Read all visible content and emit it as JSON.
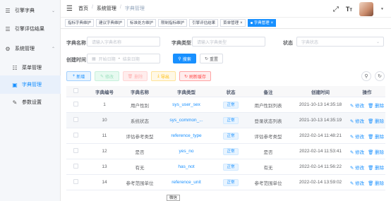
{
  "sidebar": {
    "items": [
      {
        "label": "引擎字典",
        "icon": "stack-icon",
        "arrow": "⌄"
      },
      {
        "label": "引擎评估结果",
        "icon": "stack-icon",
        "arrow": ""
      },
      {
        "label": "系统管理",
        "icon": "gear-icon",
        "arrow": "⌃"
      },
      {
        "label": "菜单管理",
        "icon": "tree-icon",
        "arrow": ""
      },
      {
        "label": "字典管理",
        "icon": "book-icon",
        "arrow": ""
      },
      {
        "label": "参数设置",
        "icon": "edit-icon",
        "arrow": ""
      }
    ]
  },
  "header": {
    "breadcrumb": [
      "首页",
      "系统管理",
      "字典管理"
    ],
    "icons": [
      "fullscreen-icon",
      "font-size-icon",
      "avatar"
    ]
  },
  "tags": [
    {
      "label": "指标字典维护",
      "active": false
    },
    {
      "label": "建议字典维护",
      "active": false
    },
    {
      "label": "标准处方维护",
      "active": false
    },
    {
      "label": "限制指标维护",
      "active": false
    },
    {
      "label": "引擎评估结果",
      "active": false
    },
    {
      "label": "菜单管理",
      "active": false,
      "closable": true
    },
    {
      "label": "字典管理",
      "active": true,
      "closable": true
    }
  ],
  "search": {
    "dict_name_label": "字典名称",
    "dict_name_placeholder": "请输入字典名称",
    "dict_type_label": "字典类型",
    "dict_type_placeholder": "请输入字典类型",
    "status_label": "状态",
    "status_placeholder": "字典状态",
    "created_label": "创建时间",
    "start_placeholder": "开始日期",
    "range_sep": "-",
    "end_placeholder": "结束日期",
    "search_btn": "搜索",
    "reset_btn": "重置"
  },
  "toolbar": {
    "add": "新增",
    "edit": "修改",
    "delete": "删除",
    "export": "导出",
    "refresh_cache": "刷新缓存"
  },
  "table": {
    "headers": [
      "字典编号",
      "字典名称",
      "字典类型",
      "状态",
      "备注",
      "创建时间",
      "操作"
    ],
    "rows": [
      {
        "id": "1",
        "name": "用户性别",
        "type": "sys_user_sex",
        "status": "正常",
        "remark": "用户性别列表",
        "created": "2021-10-13 14:35:18"
      },
      {
        "id": "10",
        "name": "系统状态",
        "type": "sys_common_...",
        "status": "正常",
        "remark": "登录状态列表",
        "created": "2021-10-13 14:35:19"
      },
      {
        "id": "11",
        "name": "评估参考类型",
        "type": "reference_type",
        "status": "正常",
        "remark": "评估参考类型",
        "created": "2022-02-14 11:48:21"
      },
      {
        "id": "12",
        "name": "是否",
        "type": "yes_no",
        "status": "正常",
        "remark": "是否",
        "created": "2022-02-14 11:53:41"
      },
      {
        "id": "13",
        "name": "有无",
        "type": "has_not",
        "status": "正常",
        "remark": "有无",
        "created": "2022-02-14 11:56:22"
      },
      {
        "id": "14",
        "name": "参考范围单位",
        "type": "reference_unit",
        "status": "正常",
        "remark": "参考范围单位",
        "created": "2022-02-14 13:59:02"
      }
    ],
    "op_edit": "修改",
    "op_delete": "删除"
  },
  "tooltip": "微信",
  "colors": {
    "primary": "#1890ff",
    "sidebar_bg": "#f5f7fa"
  }
}
